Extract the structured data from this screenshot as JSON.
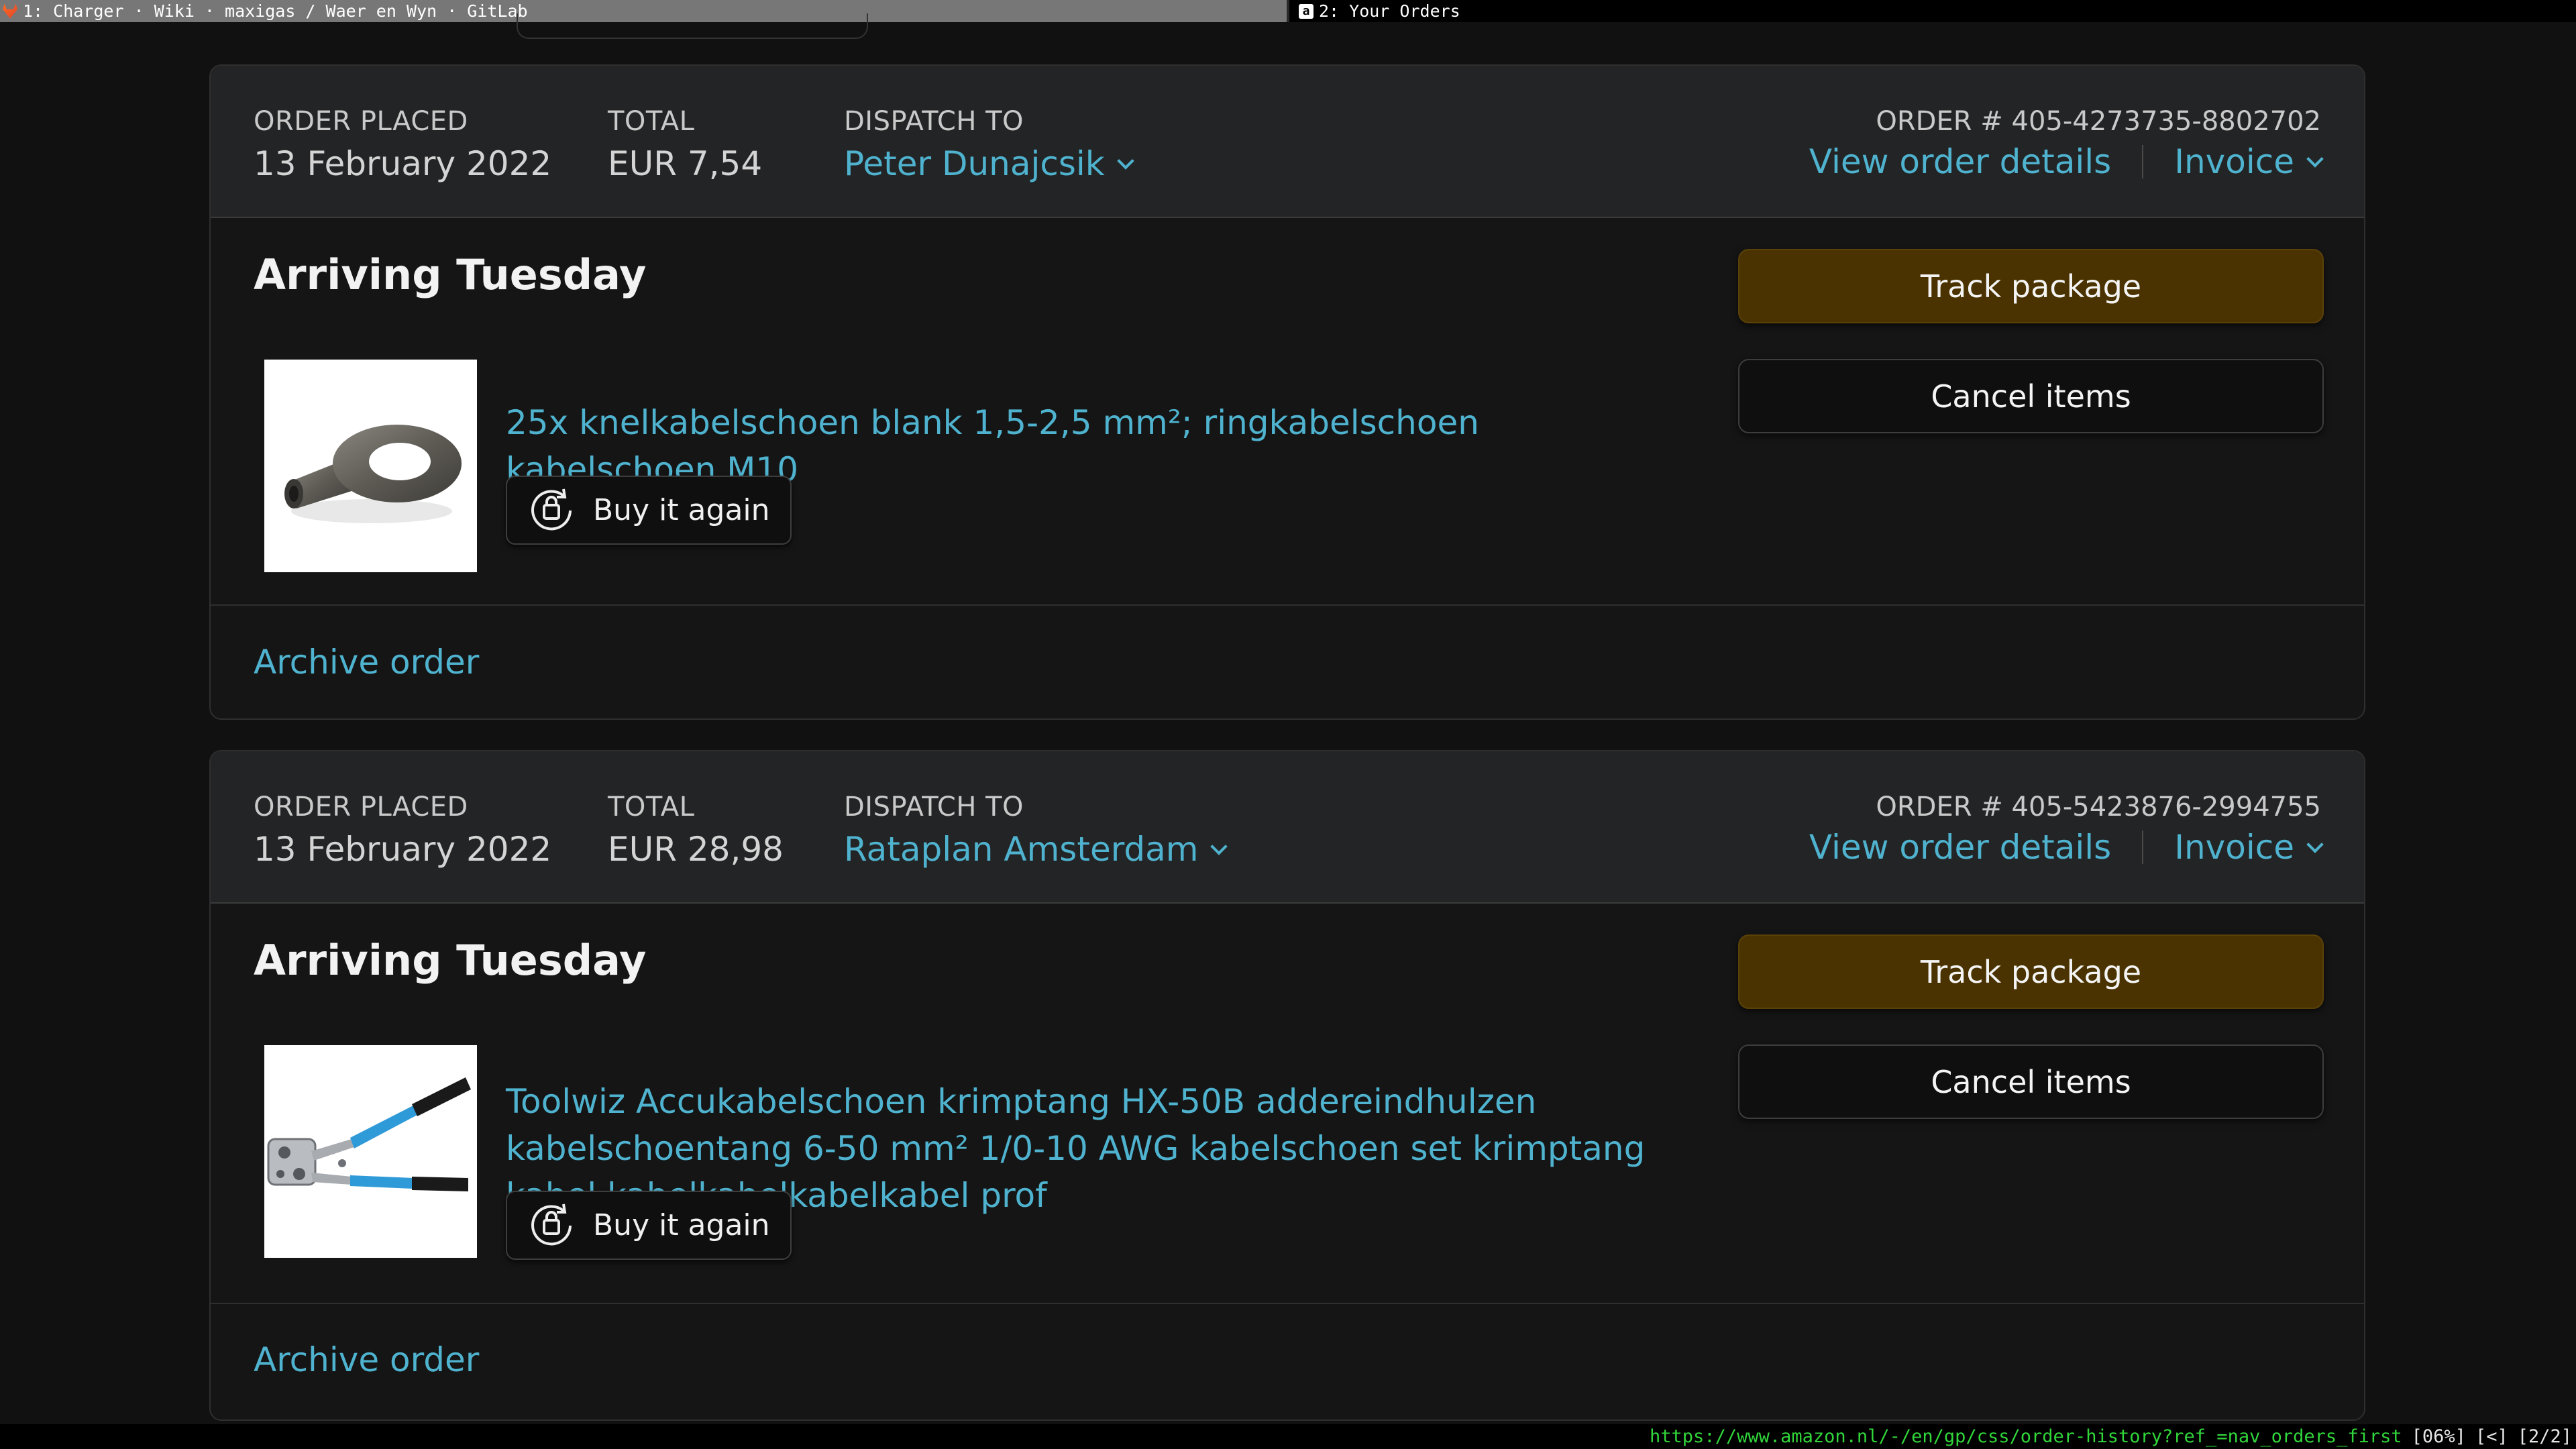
{
  "tabbar": {
    "tab1": {
      "title": "1: Charger · Wiki · maxigas / Waer en Wyn · GitLab",
      "icon": "gitlab-icon"
    },
    "tab2": {
      "title": "2: Your Orders",
      "icon": "amazon-icon",
      "icon_glyph": "a"
    }
  },
  "orders": [
    {
      "order_placed_label": "ORDER PLACED",
      "order_placed": "13 February 2022",
      "total_label": "TOTAL",
      "total": "EUR 7,54",
      "dispatch_label": "DISPATCH TO",
      "dispatch_to": "Peter Dunajcsik",
      "order_number": "ORDER # 405-4273735-8802702",
      "view_details": "View order details",
      "invoice": "Invoice",
      "status": "Arriving Tuesday",
      "item_title": "25x knelkabelschoen blank 1,5-2,5 mm²; ringkabelschoen kabelschoen M10",
      "item_image": "ring-terminal-image",
      "buy_again": "Buy it again",
      "track": "Track package",
      "cancel": "Cancel items",
      "archive": "Archive order"
    },
    {
      "order_placed_label": "ORDER PLACED",
      "order_placed": "13 February 2022",
      "total_label": "TOTAL",
      "total": "EUR 28,98",
      "dispatch_label": "DISPATCH TO",
      "dispatch_to": "Rataplan Amsterdam",
      "order_number": "ORDER # 405-5423876-2994755",
      "view_details": "View order details",
      "invoice": "Invoice",
      "status": "Arriving Tuesday",
      "item_title": "Toolwiz Accukabelschoen krimptang HX-50B addereindhulzen kabelschoentang 6-50 mm² 1/0-10 AWG kabelschoen set krimptang kabel kabelkabelkabelkabel prof",
      "item_image": "crimping-tool-image",
      "buy_again": "Buy it again",
      "track": "Track package",
      "cancel": "Cancel items",
      "archive": "Archive order"
    }
  ],
  "statusbar": {
    "url": "https://www.amazon.nl/-/en/gp/css/order-history?ref_=nav_orders_first",
    "zoom": "[06%]",
    "back": "[<]",
    "tab_index": "[2/2]"
  },
  "colors": {
    "background": "#111111",
    "header": "#232425",
    "link": "#4fb3cf",
    "track_button": "#4a3300",
    "url_green": "#31d63a"
  }
}
